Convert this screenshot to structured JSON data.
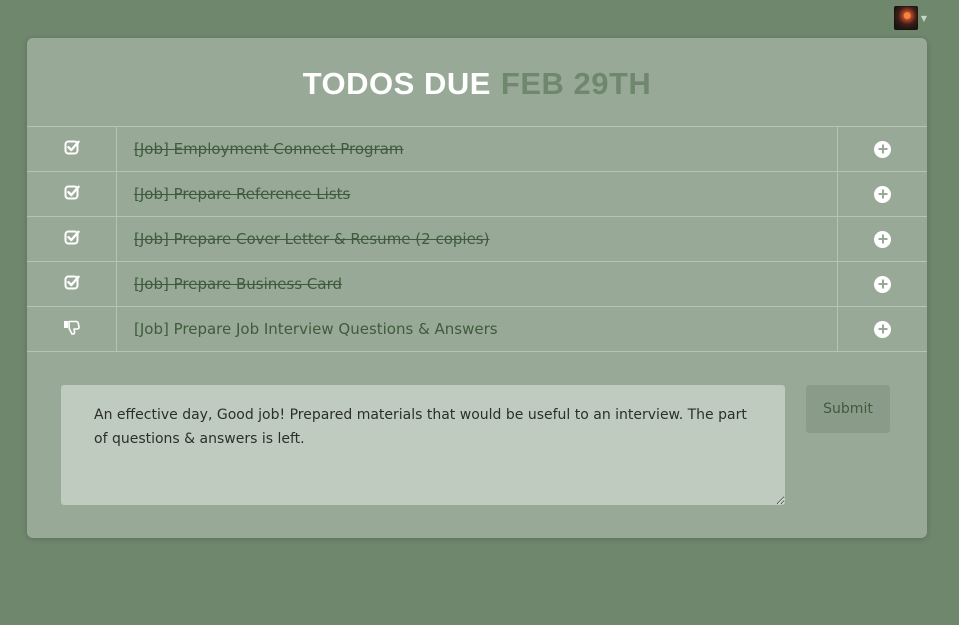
{
  "header": {
    "avatar_icon": "user-avatar",
    "menu_caret_icon": "chevron-down-icon"
  },
  "title": {
    "prefix": "TODOS DUE",
    "date": "FEB 29TH"
  },
  "colors": {
    "background": "#6f876d",
    "card": "#98aa97",
    "title_accent": "#6f876d",
    "todo_text": "#3f5a3d",
    "textarea_bg": "#c0cbc0",
    "button_bg": "#8a9c89"
  },
  "todos": [
    {
      "label": "[Job] Employment Connect Program",
      "status": "done",
      "status_icon": "check-square-icon",
      "action_icon": "plus-circle-icon"
    },
    {
      "label": "[Job] Prepare Reference Lists",
      "status": "done",
      "status_icon": "check-square-icon",
      "action_icon": "plus-circle-icon"
    },
    {
      "label": "[Job] Prepare Cover Letter & Resume (2 copies)",
      "status": "done",
      "status_icon": "check-square-icon",
      "action_icon": "plus-circle-icon"
    },
    {
      "label": "[Job] Prepare Business Card",
      "status": "done",
      "status_icon": "check-square-icon",
      "action_icon": "plus-circle-icon"
    },
    {
      "label": "[Job] Prepare Job Interview Questions & Answers",
      "status": "not-done",
      "status_icon": "thumbs-down-icon",
      "action_icon": "plus-circle-icon"
    }
  ],
  "review": {
    "value": "An effective day, Good job! Prepared materials that would be useful to an interview. The part of questions & answers is left."
  },
  "submit": {
    "label": "Submit"
  }
}
